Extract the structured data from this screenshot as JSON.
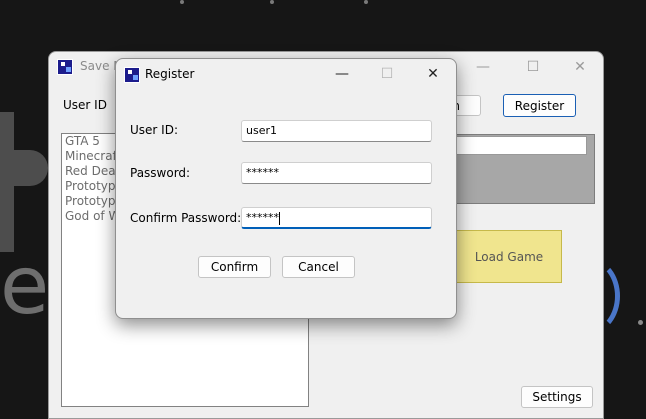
{
  "main_window": {
    "title": "Save N",
    "user_id_label": "User ID",
    "login_button_partial": "n",
    "register_button": "Register",
    "games": [
      "GTA 5",
      "Minecraft",
      "Red Dead",
      "Prototype",
      "Prototype",
      "God of W"
    ],
    "load_game_button": "Load Game",
    "settings_button": "Settings",
    "captions": {
      "minimize": "—",
      "maximize": "☐",
      "close": "✕"
    }
  },
  "register_dialog": {
    "title": "Register",
    "user_id_label": "User ID:",
    "user_id_value": "user1",
    "password_label": "Password:",
    "password_value": "******",
    "confirm_password_label": "Confirm Password:",
    "confirm_password_value": "******",
    "confirm_button": "Confirm",
    "cancel_button": "Cancel",
    "captions": {
      "minimize": "—",
      "maximize": "☐",
      "close": "✕"
    }
  },
  "background": {
    "letters_left": "e",
    "accent": "#4a76c9"
  }
}
